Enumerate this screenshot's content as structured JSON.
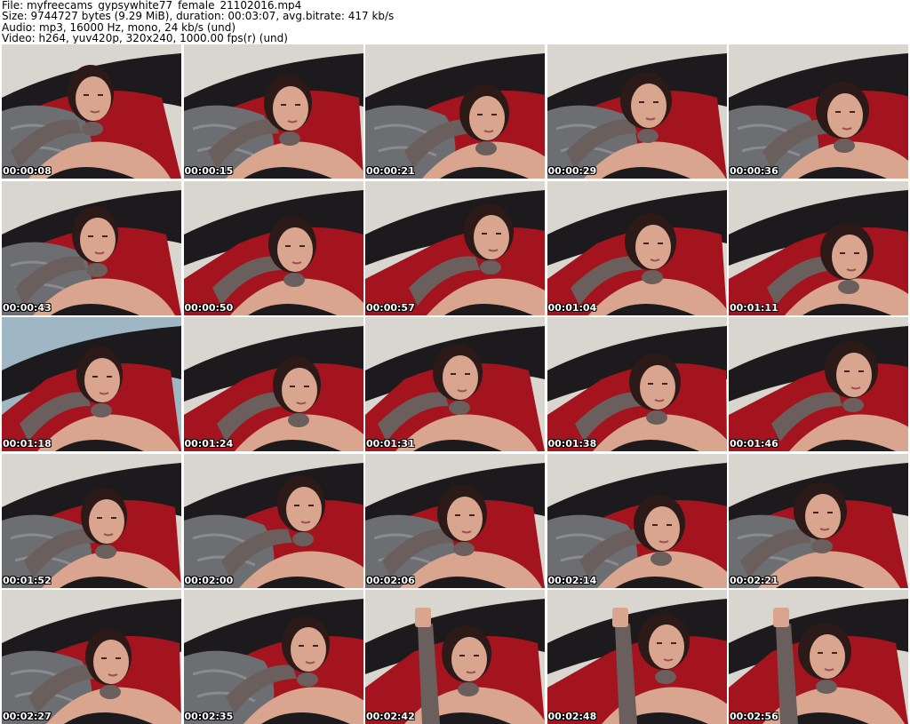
{
  "header": {
    "file_line": "File: myfreecams_gypsywhite77_female_21102016.mp4",
    "size_line": "Size: 9744727 bytes (9.29 MiB), duration: 00:03:07, avg.bitrate: 417 kb/s",
    "audio_line": "Audio: mp3, 16000 Hz, mono, 24 kb/s (und)",
    "video_line": "Video: h264, yuv420p, 320x240, 1000.00 fps(r) (und)"
  },
  "thumbnails": [
    {
      "timestamp": "00:00:08"
    },
    {
      "timestamp": "00:00:15"
    },
    {
      "timestamp": "00:00:21"
    },
    {
      "timestamp": "00:00:29"
    },
    {
      "timestamp": "00:00:36"
    },
    {
      "timestamp": "00:00:43"
    },
    {
      "timestamp": "00:00:50"
    },
    {
      "timestamp": "00:00:57"
    },
    {
      "timestamp": "00:01:04"
    },
    {
      "timestamp": "00:01:11"
    },
    {
      "timestamp": "00:01:18"
    },
    {
      "timestamp": "00:01:24"
    },
    {
      "timestamp": "00:01:31"
    },
    {
      "timestamp": "00:01:38"
    },
    {
      "timestamp": "00:01:46"
    },
    {
      "timestamp": "00:01:52"
    },
    {
      "timestamp": "00:02:00"
    },
    {
      "timestamp": "00:02:06"
    },
    {
      "timestamp": "00:02:14"
    },
    {
      "timestamp": "00:02:21"
    },
    {
      "timestamp": "00:02:27"
    },
    {
      "timestamp": "00:02:35"
    },
    {
      "timestamp": "00:02:42"
    },
    {
      "timestamp": "00:02:48"
    },
    {
      "timestamp": "00:02:56"
    }
  ],
  "colors": {
    "wall": "#d9d6d0",
    "wall_blue": "#9fb7c4",
    "pillow_red": "#a3141f",
    "blanket_gray": "#6d6e72",
    "dark": "#1c1a1c",
    "skin": "#d9a58e",
    "hair": "#2b1a18",
    "tattoo": "#6a5f5c"
  }
}
